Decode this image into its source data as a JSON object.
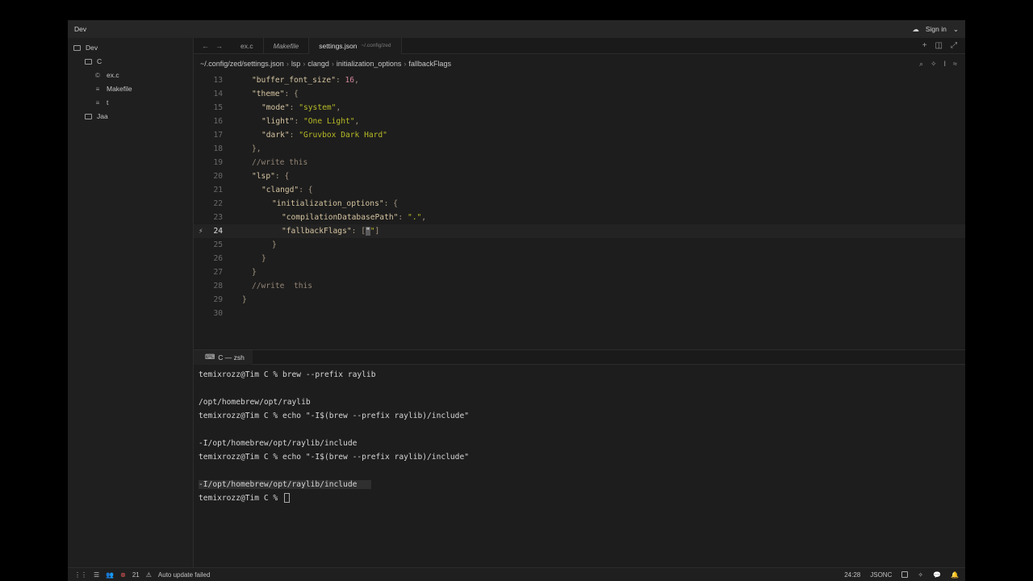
{
  "titlebar": {
    "project": "Dev",
    "sign_in": "Sign in"
  },
  "sidebar": {
    "root": "Dev",
    "items": [
      {
        "label": "C",
        "kind": "folder"
      },
      {
        "label": "ex.c",
        "kind": "file-c"
      },
      {
        "label": "Makefile",
        "kind": "file"
      },
      {
        "label": "t",
        "kind": "file"
      },
      {
        "label": "Jaa",
        "kind": "folder"
      }
    ]
  },
  "tabs": [
    {
      "label": "ex.c"
    },
    {
      "label": "Makefile"
    },
    {
      "label": "settings.json",
      "path": "~/.config/zed"
    }
  ],
  "breadcrumb": [
    "~/.config/zed/settings.json",
    "lsp",
    "clangd",
    "initialization_options",
    "fallbackFlags"
  ],
  "code_lines": [
    {
      "num": "13"
    },
    {
      "num": "14"
    },
    {
      "num": "15"
    },
    {
      "num": "16"
    },
    {
      "num": "17"
    },
    {
      "num": "18"
    },
    {
      "num": "19"
    },
    {
      "num": "20"
    },
    {
      "num": "21"
    },
    {
      "num": "22"
    },
    {
      "num": "23"
    },
    {
      "num": "24"
    },
    {
      "num": "25"
    },
    {
      "num": "26"
    },
    {
      "num": "27"
    },
    {
      "num": "28"
    },
    {
      "num": "29"
    },
    {
      "num": "30"
    }
  ],
  "code": {
    "l13_key": "\"buffer_font_size\"",
    "l13_val": "16",
    "l14_key": "\"theme\"",
    "l15_key": "\"mode\"",
    "l15_val": "\"system\"",
    "l16_key": "\"light\"",
    "l16_val": "\"One Light\"",
    "l17_key": "\"dark\"",
    "l17_val": "\"Gruvbox Dark Hard\"",
    "l19_comment": "//write this",
    "l20_key": "\"lsp\"",
    "l21_key": "\"clangd\"",
    "l22_key": "\"initialization_options\"",
    "l23_key": "\"compilationDatabasePath\"",
    "l23_val": "\".\"",
    "l24_key": "\"fallbackFlags\"",
    "l24_cursor": "\"",
    "l28_comment": "//write  this"
  },
  "terminal": {
    "tab": "C — zsh",
    "lines": [
      "temixrozz@Tim C % brew --prefix raylib",
      "",
      "/opt/homebrew/opt/raylib",
      "temixrozz@Tim C % echo \"-I$(brew --prefix raylib)/include\"",
      "",
      "-I/opt/homebrew/opt/raylib/include",
      "temixrozz@Tim C % echo \"-I$(brew --prefix raylib)/include\"",
      "",
      "-I/opt/homebrew/opt/raylib/include   ",
      "temixrozz@Tim C % "
    ]
  },
  "statusbar": {
    "errors": "21",
    "message": "Auto update failed",
    "position": "24:28",
    "language": "JSONC"
  }
}
